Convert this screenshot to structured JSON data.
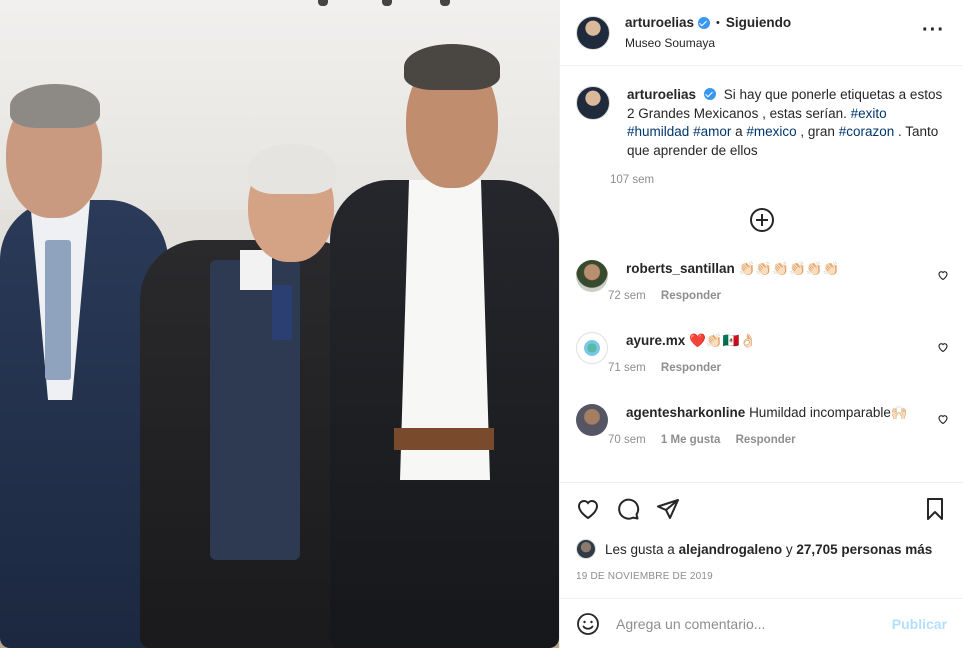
{
  "post": {
    "username": "arturoelias",
    "follow_status": "Siguiendo",
    "separator": "•",
    "location": "Museo Soumaya",
    "more_icon": "more-horizontal-icon"
  },
  "caption": {
    "username": "arturoelias",
    "text_1": "Si hay que ponerle etiquetas a estos 2 Grandes Mexicanos , estas serían.",
    "tag_1": "#exito",
    "tag_2": "#humildad",
    "tag_3": "#amor",
    "text_2": "a",
    "tag_4": "#mexico",
    "text_3": ", gran",
    "tag_5": "#corazon",
    "text_4": ". Tanto que aprender de ellos",
    "time": "107 sem"
  },
  "comments": [
    {
      "username": "roberts_santillan",
      "text": "👏🏻👏🏻👏🏻👏🏻👏🏻👏🏻",
      "time": "72 sem",
      "reply": "Responder",
      "likes": ""
    },
    {
      "username": "ayure.mx",
      "text": "❤️👏🏻🇲🇽👌🏻",
      "time": "71 sem",
      "reply": "Responder",
      "likes": ""
    },
    {
      "username": "agentesharkonline",
      "text": "Humildad incomparable🙌🏻",
      "time": "70 sem",
      "reply": "Responder",
      "likes": "1 Me gusta"
    }
  ],
  "likes": {
    "prefix": "Les gusta a",
    "user": "alejandrogaleno",
    "conjunction": "y",
    "count": "27,705 personas más"
  },
  "date": "19 de noviembre de 2019",
  "add_comment": {
    "placeholder": "Agrega un comentario...",
    "publish_label": "Publicar"
  },
  "colors": {
    "verified": "#3897f0",
    "hashtag": "#00376b",
    "muted": "#8e8e8e",
    "publish_disabled": "#b2dffc"
  }
}
